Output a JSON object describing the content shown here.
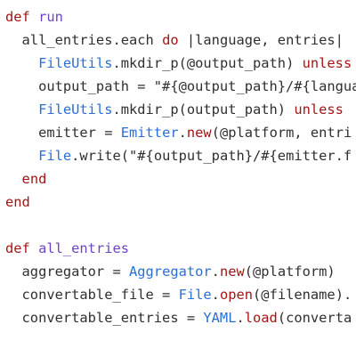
{
  "editor": {
    "lines": [
      {
        "tokens": [
          {
            "text": "def ",
            "kind": "keyword"
          },
          {
            "text": "run",
            "kind": "method"
          }
        ]
      },
      {
        "tokens": [
          {
            "text": "  all_entries.each ",
            "kind": "plain"
          },
          {
            "text": "do",
            "kind": "keyword"
          },
          {
            "text": " |language, entries|",
            "kind": "plain"
          }
        ]
      },
      {
        "tokens": [
          {
            "text": "    ",
            "kind": "plain"
          },
          {
            "text": "FileUtils",
            "kind": "constant"
          },
          {
            "text": ".mkdir_p(@output_path) ",
            "kind": "plain"
          },
          {
            "text": "unless",
            "kind": "keyword"
          }
        ]
      },
      {
        "tokens": [
          {
            "text": "    output_path = \"#{@output_path}/#{langua",
            "kind": "plain"
          }
        ]
      },
      {
        "tokens": [
          {
            "text": "    ",
            "kind": "plain"
          },
          {
            "text": "FileUtils",
            "kind": "constant"
          },
          {
            "text": ".mkdir_p(output_path) ",
            "kind": "plain"
          },
          {
            "text": "unless",
            "kind": "keyword"
          }
        ]
      },
      {
        "tokens": [
          {
            "text": "    emitter = ",
            "kind": "plain"
          },
          {
            "text": "Emitter",
            "kind": "constant"
          },
          {
            "text": ".",
            "kind": "plain"
          },
          {
            "text": "new",
            "kind": "keyword"
          },
          {
            "text": "(@platform, entri",
            "kind": "plain"
          }
        ]
      },
      {
        "tokens": [
          {
            "text": "    ",
            "kind": "plain"
          },
          {
            "text": "File",
            "kind": "constant"
          },
          {
            "text": ".write(\"#{output_path}/#{emitter.f",
            "kind": "plain"
          }
        ]
      },
      {
        "tokens": [
          {
            "text": "  ",
            "kind": "plain"
          },
          {
            "text": "end",
            "kind": "keyword"
          }
        ]
      },
      {
        "tokens": [
          {
            "text": "end",
            "kind": "keyword"
          }
        ]
      },
      {
        "tokens": []
      },
      {
        "tokens": [
          {
            "text": "def ",
            "kind": "keyword"
          },
          {
            "text": "all_entries",
            "kind": "method"
          }
        ]
      },
      {
        "tokens": [
          {
            "text": "  aggregator = ",
            "kind": "plain"
          },
          {
            "text": "Aggregator",
            "kind": "constant"
          },
          {
            "text": ".",
            "kind": "plain"
          },
          {
            "text": "new",
            "kind": "keyword"
          },
          {
            "text": "(@platform)",
            "kind": "plain"
          }
        ]
      },
      {
        "tokens": [
          {
            "text": "  convertable_file = ",
            "kind": "plain"
          },
          {
            "text": "File",
            "kind": "constant"
          },
          {
            "text": ".",
            "kind": "plain"
          },
          {
            "text": "open",
            "kind": "keyword"
          },
          {
            "text": "(@filename).",
            "kind": "plain"
          }
        ]
      },
      {
        "tokens": [
          {
            "text": "  convertable_entries = ",
            "kind": "plain"
          },
          {
            "text": "YAML",
            "kind": "constant"
          },
          {
            "text": ".",
            "kind": "plain"
          },
          {
            "text": "load",
            "kind": "keyword"
          },
          {
            "text": "(converta",
            "kind": "plain"
          }
        ]
      }
    ]
  },
  "colors": {
    "keyword": "#a31515",
    "method": "#6f42c1",
    "constant": "#2a6fd6",
    "plain": "#2f2f2f",
    "background": "#ffffff"
  }
}
